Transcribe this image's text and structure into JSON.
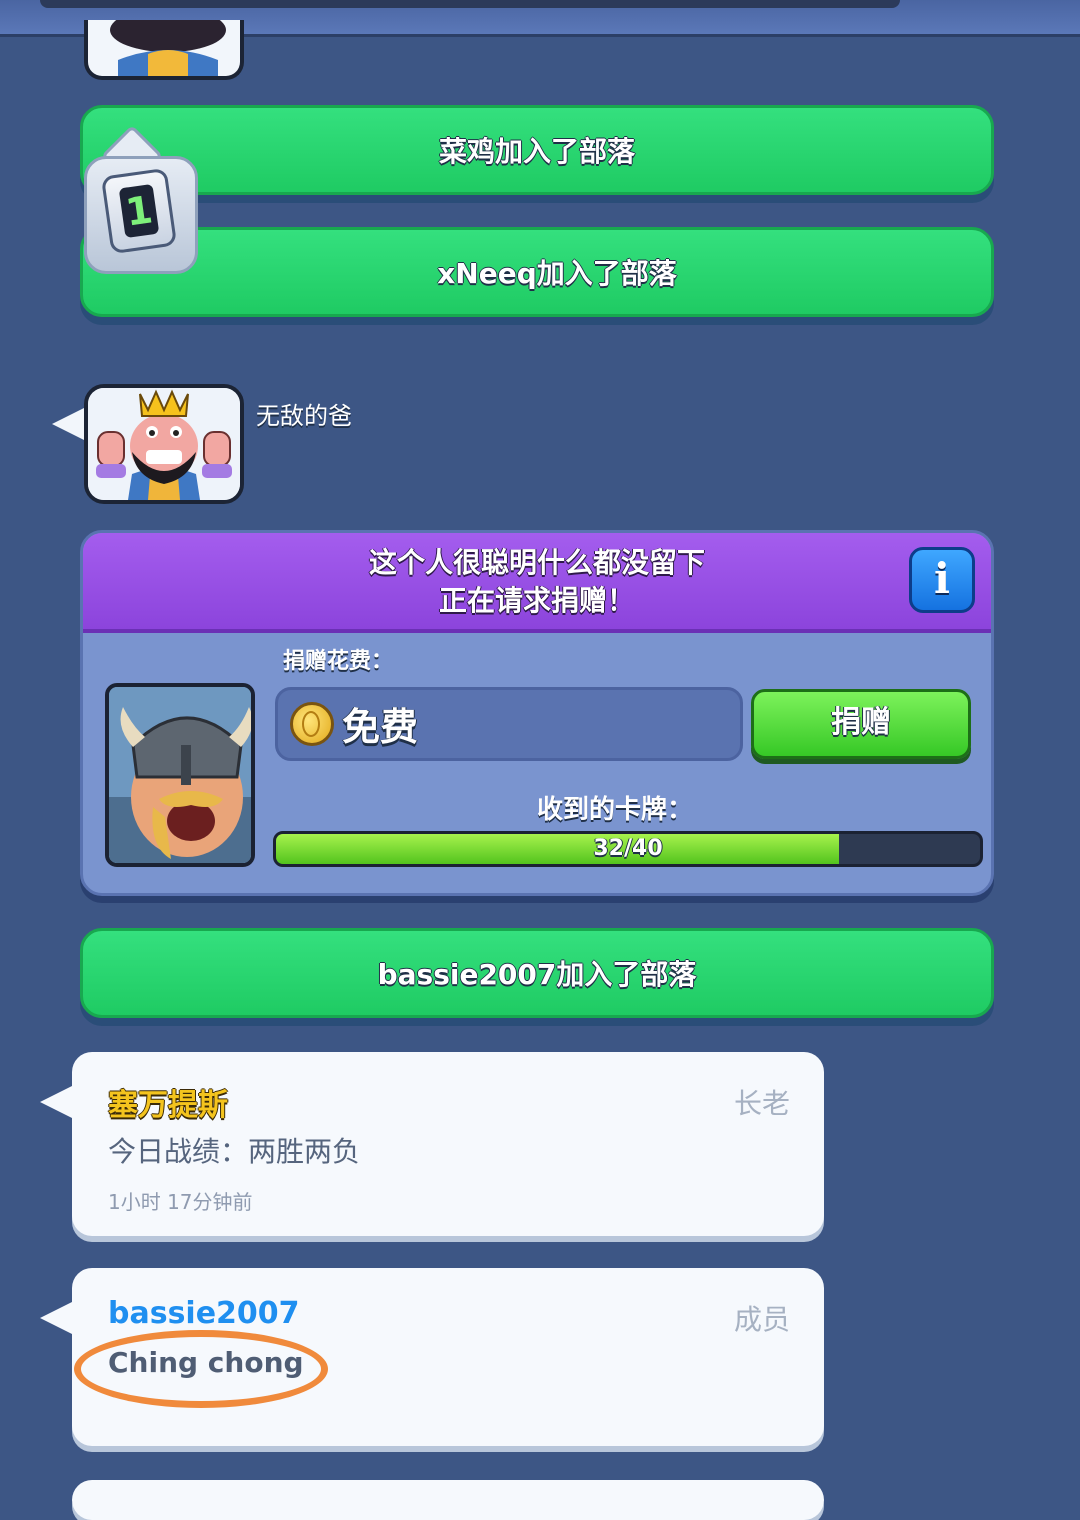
{
  "feed": {
    "join_1": "菜鸡加入了部落",
    "join_2": "xNeeq加入了部落",
    "badge_number": "1",
    "sender_name": "无敌的爸",
    "request": {
      "line1": "这个人很聪明什么都没留下",
      "line2": "正在请求捐赠！",
      "info_icon": "i",
      "cost_label": "捐赠花费：",
      "cost_value": "免费",
      "donate_label": "捐赠",
      "cards_received_label": "收到的卡牌：",
      "progress_text": "32/40",
      "progress_fraction": 0.8
    },
    "join_3": "bassie2007加入了部落",
    "messages": [
      {
        "name": "塞万提斯",
        "role": "长老",
        "text": "今日战绩：两胜两负",
        "time": "1小时 17分钟前"
      },
      {
        "name": "bassie2007",
        "role": "成员",
        "text": "Ching chong"
      }
    ]
  },
  "colors": {
    "background": "#3d5685",
    "banner_green": "#27d76f",
    "request_purple": "#9650e4",
    "progress_green": "#7ed83a",
    "highlight_orange": "#f08a3c"
  }
}
